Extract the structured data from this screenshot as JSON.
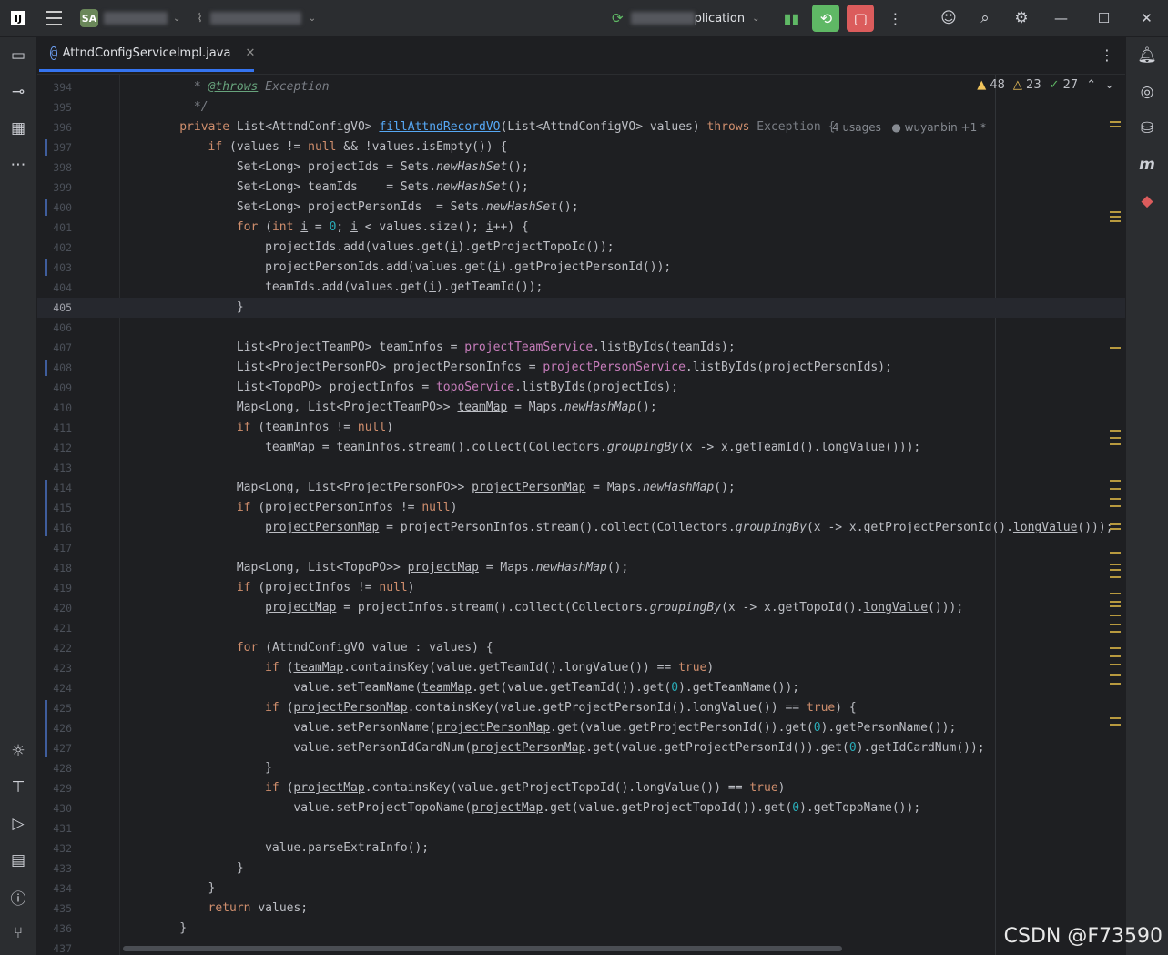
{
  "titlebar": {
    "logo_text": "IJ",
    "project_badge": "SA",
    "run_config_suffix": "plication",
    "icons": [
      "menu-icon",
      "run-icon",
      "debug-icon",
      "stop-icon",
      "more-icon",
      "add-user-icon",
      "search-icon",
      "settings-icon"
    ]
  },
  "tab": {
    "filename": "AttndConfigServiceImpl.java"
  },
  "inspection": {
    "warnings": "48",
    "weak_warnings": "23",
    "typos": "27"
  },
  "method_hint": {
    "usages": "4 usages",
    "author": "wuyanbin +1 *"
  },
  "lines": [
    {
      "n": "394"
    },
    {
      "n": "395"
    },
    {
      "n": "396"
    },
    {
      "n": "397"
    },
    {
      "n": "398"
    },
    {
      "n": "399"
    },
    {
      "n": "400"
    },
    {
      "n": "401"
    },
    {
      "n": "402"
    },
    {
      "n": "403"
    },
    {
      "n": "404"
    },
    {
      "n": "405"
    },
    {
      "n": "406"
    },
    {
      "n": "407"
    },
    {
      "n": "408"
    },
    {
      "n": "409"
    },
    {
      "n": "410"
    },
    {
      "n": "411"
    },
    {
      "n": "412"
    },
    {
      "n": "413"
    },
    {
      "n": "414"
    },
    {
      "n": "415"
    },
    {
      "n": "416"
    },
    {
      "n": "417"
    },
    {
      "n": "418"
    },
    {
      "n": "419"
    },
    {
      "n": "420"
    },
    {
      "n": "421"
    },
    {
      "n": "422"
    },
    {
      "n": "423"
    },
    {
      "n": "424"
    },
    {
      "n": "425"
    },
    {
      "n": "426"
    },
    {
      "n": "427"
    },
    {
      "n": "428"
    },
    {
      "n": "429"
    },
    {
      "n": "430"
    },
    {
      "n": "431"
    },
    {
      "n": "432"
    },
    {
      "n": "433"
    },
    {
      "n": "434"
    },
    {
      "n": "435"
    },
    {
      "n": "436"
    },
    {
      "n": "437"
    }
  ],
  "code": {
    "l394": "* @throws Exception",
    "l395": "*/",
    "l396_a": "private ",
    "l396_b": "List<AttndConfigVO> ",
    "l396_c": "fillAttndRecordVO",
    "l396_d": "(List<AttndConfigVO> values) ",
    "l396_e": "throws ",
    "l396_f": "Exception {",
    "l397_a": "if ",
    "l397_b": "(values != ",
    "l397_c": "null",
    "l397_d": " && !values.isEmpty()) {",
    "l398_a": "Set<Long> projectIds = Sets.",
    "l398_b": "newHashSet",
    "l398_c": "();",
    "l399_a": "Set<Long> teamIds    = Sets.",
    "l399_b": "newHashSet",
    "l399_c": "();",
    "l400_a": "Set<Long> projectPersonIds  = Sets.",
    "l400_b": "newHashSet",
    "l400_c": "();",
    "l401_a": "for ",
    "l401_b": "(",
    "l401_c": "int ",
    "l401_d": "i",
    "l401_e": " = ",
    "l401_f": "0",
    "l401_g": "; ",
    "l401_h": "i",
    "l401_i": " < values.size(); ",
    "l401_j": "i",
    "l401_k": "++) {",
    "l402_a": "projectIds.add(values.get(",
    "l402_b": "i",
    "l402_c": ").getProjectTopoId());",
    "l403_a": "projectPersonIds.add(values.get(",
    "l403_b": "i",
    "l403_c": ").getProjectPersonId());",
    "l404_a": "teamIds.add(values.get(",
    "l404_b": "i",
    "l404_c": ").getTeamId());",
    "l405": "}",
    "l407_a": "List<ProjectTeamPO> teamInfos = ",
    "l407_b": "projectTeamService",
    "l407_c": ".listByIds(teamIds);",
    "l408_a": "List<ProjectPersonPO> projectPersonInfos = ",
    "l408_b": "projectPersonService",
    "l408_c": ".listByIds(projectPersonIds);",
    "l409_a": "List<TopoPO> projectInfos = ",
    "l409_b": "topoService",
    "l409_c": ".listByIds(projectIds);",
    "l410_a": "Map<Long, List<ProjectTeamPO>> ",
    "l410_b": "teamMap",
    "l410_c": " = Maps.",
    "l410_d": "newHashMap",
    "l410_e": "();",
    "l411_a": "if ",
    "l411_b": "(teamInfos != ",
    "l411_c": "null",
    "l411_d": ")",
    "l412_a": "teamMap",
    "l412_b": " = teamInfos.stream().collect(Collectors.",
    "l412_c": "groupingBy",
    "l412_d": "(x -> x.getTeamId().",
    "l412_e": "longValue",
    "l412_f": "()));",
    "l414_a": "Map<Long, List<ProjectPersonPO>> ",
    "l414_b": "projectPersonMap",
    "l414_c": " = Maps.",
    "l414_d": "newHashMap",
    "l414_e": "();",
    "l415_a": "if ",
    "l415_b": "(projectPersonInfos != ",
    "l415_c": "null",
    "l415_d": ")",
    "l416_a": "projectPersonMap",
    "l416_b": " = projectPersonInfos.stream().collect(Collectors.",
    "l416_c": "groupingBy",
    "l416_d": "(x -> x.getProjectPersonId().",
    "l416_e": "longValue",
    "l416_f": "()));",
    "l418_a": "Map<Long, List<TopoPO>> ",
    "l418_b": "projectMap",
    "l418_c": " = Maps.",
    "l418_d": "newHashMap",
    "l418_e": "();",
    "l419_a": "if ",
    "l419_b": "(projectInfos != ",
    "l419_c": "null",
    "l419_d": ")",
    "l420_a": "projectMap",
    "l420_b": " = projectInfos.stream().collect(Collectors.",
    "l420_c": "groupingBy",
    "l420_d": "(x -> x.getTopoId().",
    "l420_e": "longValue",
    "l420_f": "()));",
    "l422_a": "for ",
    "l422_b": "(AttndConfigVO value : values) {",
    "l423_a": "if ",
    "l423_b": "(",
    "l423_c": "teamMap",
    "l423_d": ".containsKey(value.getTeamId().longValue()) == ",
    "l423_e": "true",
    "l423_f": ")",
    "l424_a": "value.setTeamName(",
    "l424_b": "teamMap",
    "l424_c": ".get(value.getTeamId()).get(",
    "l424_d": "0",
    "l424_e": ").getTeamName());",
    "l425_a": "if ",
    "l425_b": "(",
    "l425_c": "projectPersonMap",
    "l425_d": ".containsKey(value.getProjectPersonId().longValue()) == ",
    "l425_e": "true",
    "l425_f": ") {",
    "l426_a": "value.setPersonName(",
    "l426_b": "projectPersonMap",
    "l426_c": ".get(value.getProjectPersonId()).get(",
    "l426_d": "0",
    "l426_e": ").getPersonName());",
    "l427_a": "value.setPersonIdCardNum(",
    "l427_b": "projectPersonMap",
    "l427_c": ".get(value.getProjectPersonId()).get(",
    "l427_d": "0",
    "l427_e": ").getIdCardNum());",
    "l428": "}",
    "l429_a": "if ",
    "l429_b": "(",
    "l429_c": "projectMap",
    "l429_d": ".containsKey(value.getProjectTopoId().longValue()) == ",
    "l429_e": "true",
    "l429_f": ")",
    "l430_a": "value.setProjectTopoName(",
    "l430_b": "projectMap",
    "l430_c": ".get(value.getProjectTopoId()).get(",
    "l430_d": "0",
    "l430_e": ").getTopoName());",
    "l432": "value.parseExtraInfo();",
    "l433": "}",
    "l434": "}",
    "l435_a": "return ",
    "l435_b": "values;",
    "l436": "}"
  },
  "watermark": "CSDN @F73590"
}
